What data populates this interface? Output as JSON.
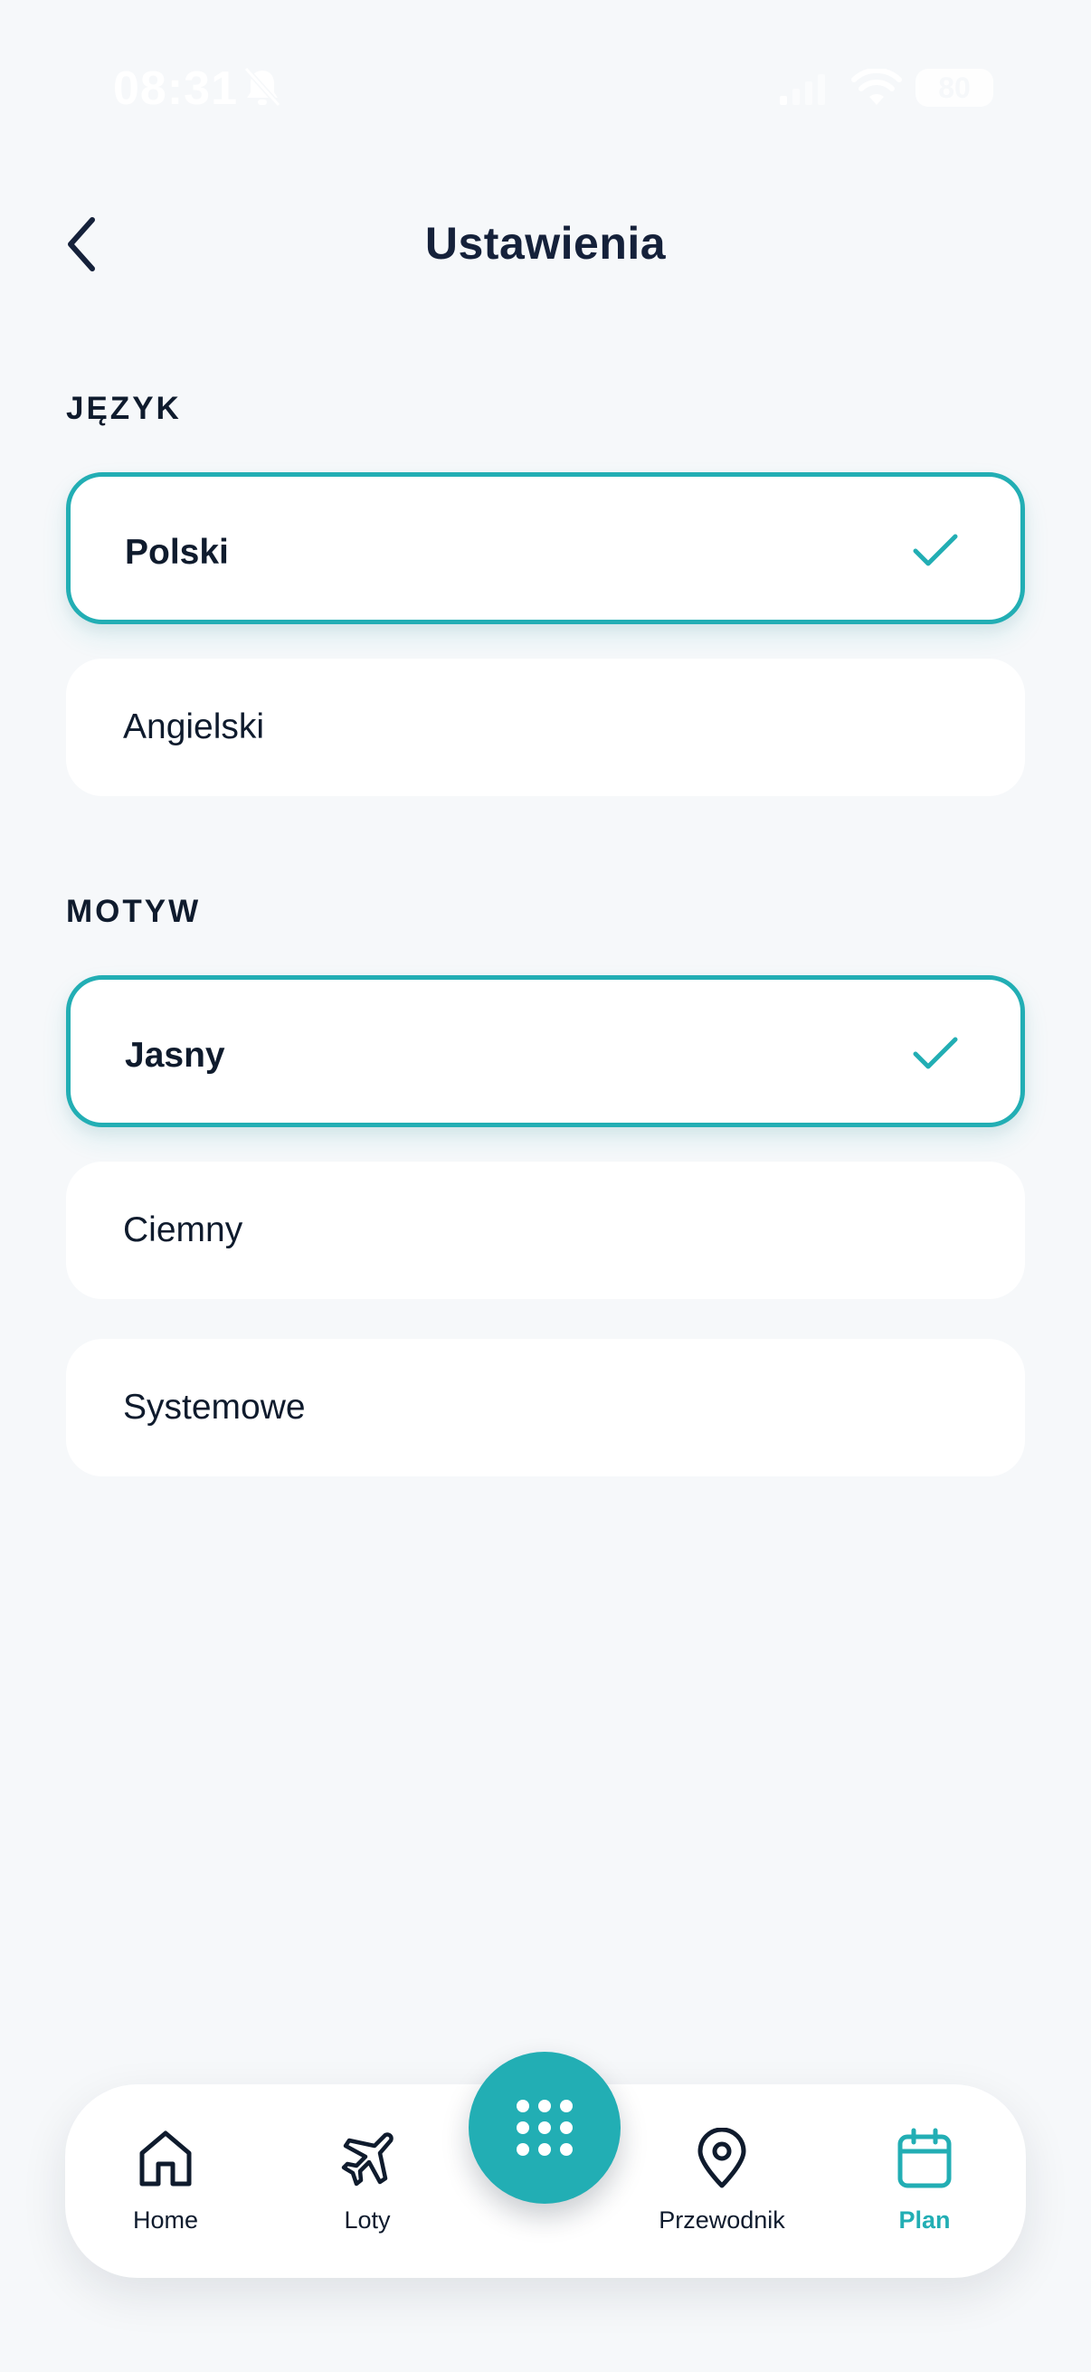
{
  "status_bar": {
    "time": "08:31",
    "battery": "80"
  },
  "header": {
    "title": "Ustawienia"
  },
  "sections": {
    "language": {
      "label": "JĘZYK",
      "options": [
        {
          "label": "Polski",
          "selected": true
        },
        {
          "label": "Angielski",
          "selected": false
        }
      ]
    },
    "theme": {
      "label": "MOTYW",
      "options": [
        {
          "label": "Jasny",
          "selected": true
        },
        {
          "label": "Ciemny",
          "selected": false
        },
        {
          "label": "Systemowe",
          "selected": false
        }
      ]
    }
  },
  "bottom_nav": {
    "items": [
      {
        "label": "Home",
        "icon": "home-icon"
      },
      {
        "label": "Loty",
        "icon": "airplane-icon"
      },
      {
        "label": "Przewodnik",
        "icon": "location-pin-icon"
      },
      {
        "label": "Plan",
        "icon": "calendar-icon",
        "active": true
      }
    ],
    "fab_icon": "grid-menu-icon"
  },
  "colors": {
    "accent": "#22aeb4",
    "background": "#f6f8fa",
    "text": "#0f1b2d"
  }
}
